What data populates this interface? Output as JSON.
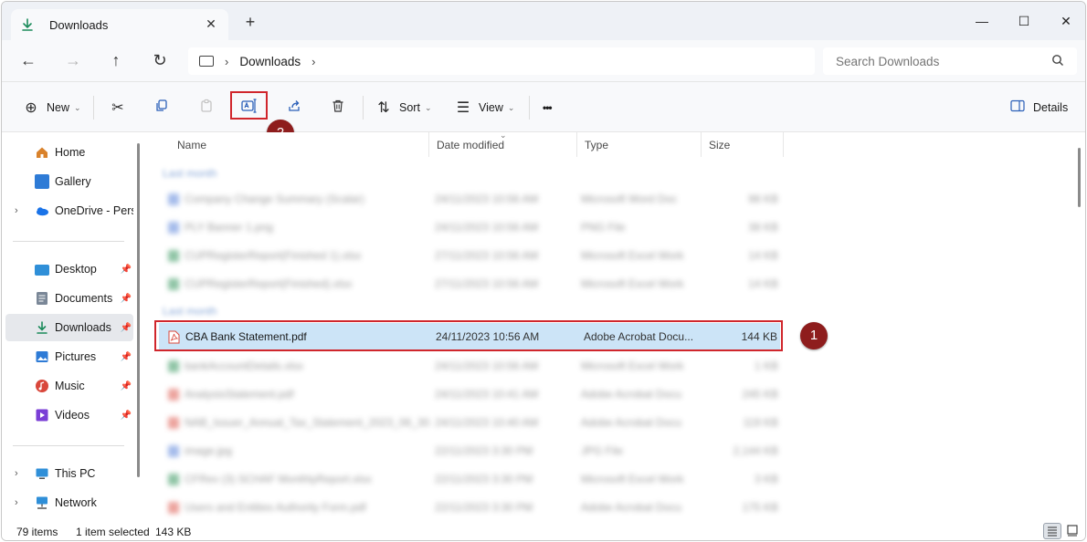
{
  "window": {
    "tab_title": "Downloads",
    "tab_icon": "download-icon",
    "new_tab": "+",
    "controls": {
      "minimize": "—",
      "maximize": "☐",
      "close": "✕"
    }
  },
  "navigation": {
    "back": "←",
    "forward": "→",
    "up": "↑",
    "refresh": "↻",
    "breadcrumb": [
      "Downloads"
    ],
    "search_placeholder": "Search Downloads"
  },
  "toolbar": {
    "new_label": "New",
    "sort_label": "Sort",
    "view_label": "View",
    "more_label": "•••",
    "details_label": "Details",
    "icons": [
      "plus-circle-icon",
      "cut-icon",
      "copy-icon",
      "paste-icon",
      "rename-icon",
      "share-icon",
      "delete-icon"
    ]
  },
  "annotations": {
    "badge_1": "1",
    "badge_2": "2"
  },
  "sidebar": {
    "items": [
      {
        "label": "Home",
        "icon": "home-icon",
        "color": "#d9822b"
      },
      {
        "label": "Gallery",
        "icon": "gallery-icon",
        "color": "#2e7bd6"
      },
      {
        "label": "OneDrive - Perso",
        "icon": "onedrive-icon",
        "color": "#1a73e8"
      },
      {
        "label": "Desktop",
        "icon": "desktop-icon",
        "color": "#2f8fd8"
      },
      {
        "label": "Documents",
        "icon": "documents-icon",
        "color": "#7a8797"
      },
      {
        "label": "Downloads",
        "icon": "download-icon",
        "color": "#1a8a5a"
      },
      {
        "label": "Pictures",
        "icon": "pictures-icon",
        "color": "#2e7bd6"
      },
      {
        "label": "Music",
        "icon": "music-icon",
        "color": "#d9473b"
      },
      {
        "label": "Videos",
        "icon": "videos-icon",
        "color": "#7a3ed6"
      },
      {
        "label": "This PC",
        "icon": "this-pc-icon",
        "color": "#2f8fd8"
      },
      {
        "label": "Network",
        "icon": "network-icon",
        "color": "#2f8fd8"
      }
    ]
  },
  "columns": {
    "name": "Name",
    "date": "Date modified",
    "type": "Type",
    "size": "Size"
  },
  "file_list": {
    "groups": [
      "Last month",
      "Last month"
    ],
    "blurred_rows": [
      {
        "name": "Company Change Summary (Scalar)",
        "date": "24/11/2023 10:56 AM",
        "type": "Microsoft Word Doc",
        "size": "98 KB",
        "color": "#4a78d6"
      },
      {
        "name": "PLY Banner 1.png",
        "date": "24/11/2023 10:56 AM",
        "type": "PNG File",
        "size": "38 KB",
        "color": "#4a78d6"
      },
      {
        "name": "CUPRegisterReport(Finished 1).xlsx",
        "date": "27/11/2023 10:56 AM",
        "type": "Microsoft Excel Work",
        "size": "14 KB",
        "color": "#1f8a4c"
      },
      {
        "name": "CUPRegisterReport(Finished).xlsx",
        "date": "27/11/2023 10:56 AM",
        "type": "Microsoft Excel Work",
        "size": "14 KB",
        "color": "#1f8a4c"
      },
      {
        "name": "bankAccountDetails.xlsx",
        "date": "24/11/2023 10:56 AM",
        "type": "Microsoft Excel Work",
        "size": "1 KB",
        "color": "#1f8a4c"
      },
      {
        "name": "AnalysisStatement.pdf",
        "date": "24/11/2023 10:41 AM",
        "type": "Adobe Acrobat Docu",
        "size": "245 KB",
        "color": "#d9473b"
      },
      {
        "name": "NAB_Issuer_Annual_Tax_Statement_2023_06_30.pdf",
        "date": "24/11/2023 10:40 AM",
        "type": "Adobe Acrobat Docu",
        "size": "119 KB",
        "color": "#d9473b"
      },
      {
        "name": "image.jpg",
        "date": "22/11/2023 3:30 PM",
        "type": "JPG File",
        "size": "2,144 KB",
        "color": "#4a78d6"
      },
      {
        "name": "CFRev (3) SCHAF MonthlyReport.xlsx",
        "date": "22/11/2023 3:30 PM",
        "type": "Microsoft Excel Work",
        "size": "3 KB",
        "color": "#1f8a4c"
      },
      {
        "name": "Users and Entities Authority Form.pdf",
        "date": "22/11/2023 3:30 PM",
        "type": "Adobe Acrobat Docu",
        "size": "175 KB",
        "color": "#d9473b"
      }
    ],
    "selected_row": {
      "name": "CBA Bank Statement.pdf",
      "date": "24/11/2023 10:56 AM",
      "type": "Adobe Acrobat Docu...",
      "size": "144 KB",
      "icon": "pdf-icon"
    }
  },
  "status": {
    "item_count": "79 items",
    "selection": "1 item selected",
    "selection_size": "143 KB"
  }
}
